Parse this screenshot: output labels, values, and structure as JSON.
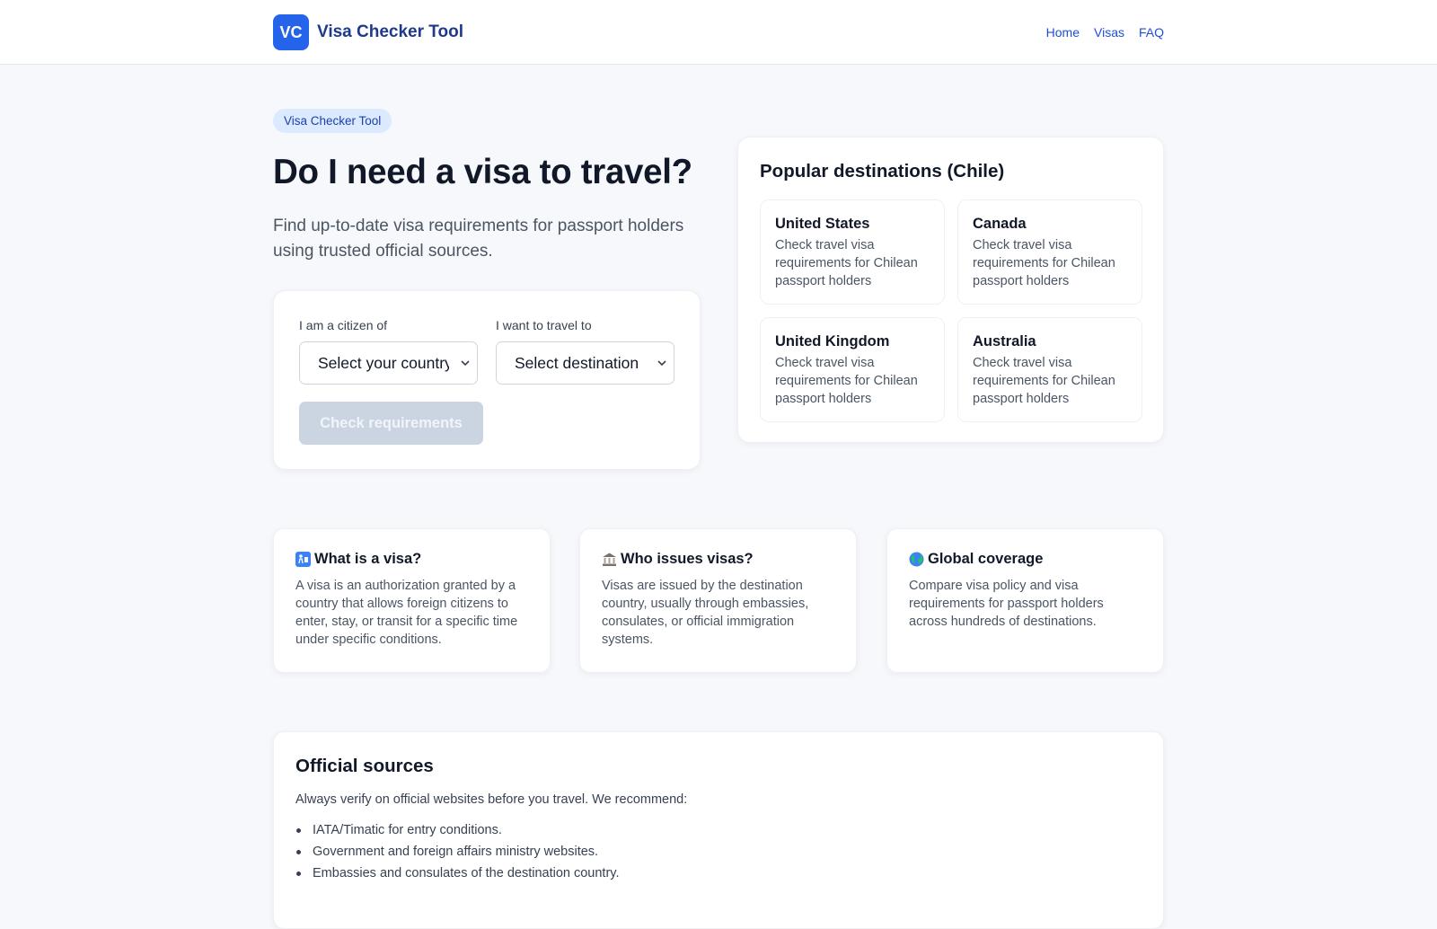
{
  "header": {
    "logo_text": "VC",
    "brand": "Visa Checker Tool",
    "nav": [
      "Home",
      "Visas",
      "FAQ"
    ]
  },
  "hero": {
    "pill": "Visa Checker Tool",
    "title": "Do I need a visa to travel?",
    "subtitle": "Find up-to-date visa requirements for passport holders using trusted official sources."
  },
  "search": {
    "citizen_label": "I am a citizen of",
    "citizen_value": "Select your country",
    "destination_label": "I want to travel to",
    "destination_value": "Select destination",
    "button": "Check requirements"
  },
  "popular": {
    "title": "Popular destinations (Chile)",
    "items": [
      {
        "name": "United States",
        "desc": "Check travel visa requirements for Chilean passport holders"
      },
      {
        "name": "Canada",
        "desc": "Check travel visa requirements for Chilean passport holders"
      },
      {
        "name": "United Kingdom",
        "desc": "Check travel visa requirements for Chilean passport holders"
      },
      {
        "name": "Australia",
        "desc": "Check travel visa requirements for Chilean passport holders"
      }
    ]
  },
  "info": [
    {
      "icon": "passport-control-icon",
      "title": "What is a visa?",
      "text": "A visa is an authorization granted by a country that allows foreign citizens to enter, stay, or transit for a specific time under specific conditions."
    },
    {
      "icon": "classical-building-icon",
      "title": "Who issues visas?",
      "text": "Visas are issued by the destination country, usually through embassies, consulates, or official immigration systems."
    },
    {
      "icon": "globe-icon",
      "title": "Global coverage",
      "text": "Compare visa policy and visa requirements for passport holders across hundreds of destinations."
    }
  ],
  "sources": {
    "title": "Official sources",
    "intro": "Always verify on official websites before you travel. We recommend:",
    "items": [
      "IATA/Timatic for entry conditions.",
      "Government and foreign affairs ministry websites.",
      "Embassies and consulates of the destination country."
    ]
  },
  "colors": {
    "accent": "#2563eb",
    "brand_text": "#1e3a8a",
    "button_disabled": "#cbd5e1",
    "pill_bg": "#dbeafe",
    "page_bg": "#f6f8fb"
  }
}
